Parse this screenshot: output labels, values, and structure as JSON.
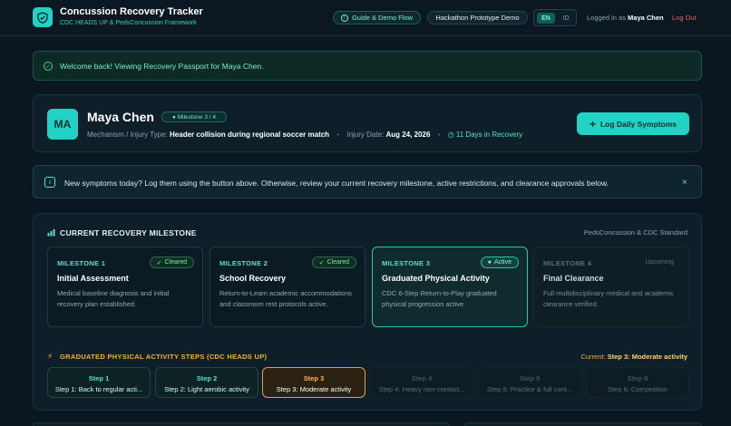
{
  "header": {
    "title": "Concussion Recovery Tracker",
    "subtitle": "CDC HEADS UP & PedsConcussion Framework",
    "guide_label": "Guide & Demo Flow",
    "demo_label": "Hackathon Prototype Demo",
    "lang_en": "EN",
    "lang_id": "ID",
    "logged_in_prefix": "Logged in as",
    "user_name": "Maya Chen",
    "logout_label": "Log Out"
  },
  "welcome": {
    "text": "Welcome back! Viewing Recovery Passport for Maya Chen."
  },
  "patient": {
    "initials": "MA",
    "name": "Maya Chen",
    "milestone_badge": "Milestone 3 / 4",
    "mechanism_label": "Mechanism / Injury Type:",
    "mechanism_value": "Header collision during regional soccer match",
    "injury_date_label": "Injury Date:",
    "injury_date_value": "Aug 24, 2026",
    "days_in_recovery": "11 Days in Recovery",
    "log_button": "Log Daily Symptoms"
  },
  "info": {
    "text": "New symptoms today? Log them using the button above. Otherwise, review your current recovery milestone, active restrictions, and clearance approvals below.",
    "close": "×"
  },
  "milestones": {
    "title": "CURRENT RECOVERY MILESTONE",
    "standard": "PedsConcussion & CDC Standard",
    "items": [
      {
        "label": "MILESTONE 1",
        "status": "Cleared",
        "title": "Initial Assessment",
        "desc": "Medical baseline diagnosis and initial recovery plan established."
      },
      {
        "label": "MILESTONE 2",
        "status": "Cleared",
        "title": "School Recovery",
        "desc": "Return-to-Learn academic accommodations and classroom rest protocols active."
      },
      {
        "label": "MILESTONE 3",
        "status": "Active",
        "title": "Graduated Physical Activity",
        "desc": "CDC 6-Step Return-to-Play graduated physical progression active."
      },
      {
        "label": "MILESTONE 4",
        "status": "Upcoming",
        "title": "Final Clearance",
        "desc": "Full multidisciplinary medical and academic clearance verified."
      }
    ]
  },
  "gpa": {
    "title": "GRADUATED PHYSICAL ACTIVITY STEPS (CDC HEADS UP)",
    "current_prefix": "Current:",
    "current_value": "Step 3: Moderate activity",
    "steps": [
      {
        "name": "Step 1",
        "label": "Step 1: Back to regular acti..."
      },
      {
        "name": "Step 2",
        "label": "Step 2: Light aerobic activity"
      },
      {
        "name": "Step 3",
        "label": "Step 3: Moderate activity"
      },
      {
        "name": "Step 4",
        "label": "Step 4: Heavy non-contact..."
      },
      {
        "name": "Step 5",
        "label": "Step 5: Practice & full cont..."
      },
      {
        "name": "Step 6",
        "label": "Step 6: Competition"
      }
    ]
  },
  "colors": {
    "accent": "#22d3c5",
    "background": "#0a1620",
    "warning": "#f0b429",
    "danger": "#f05b5b"
  }
}
